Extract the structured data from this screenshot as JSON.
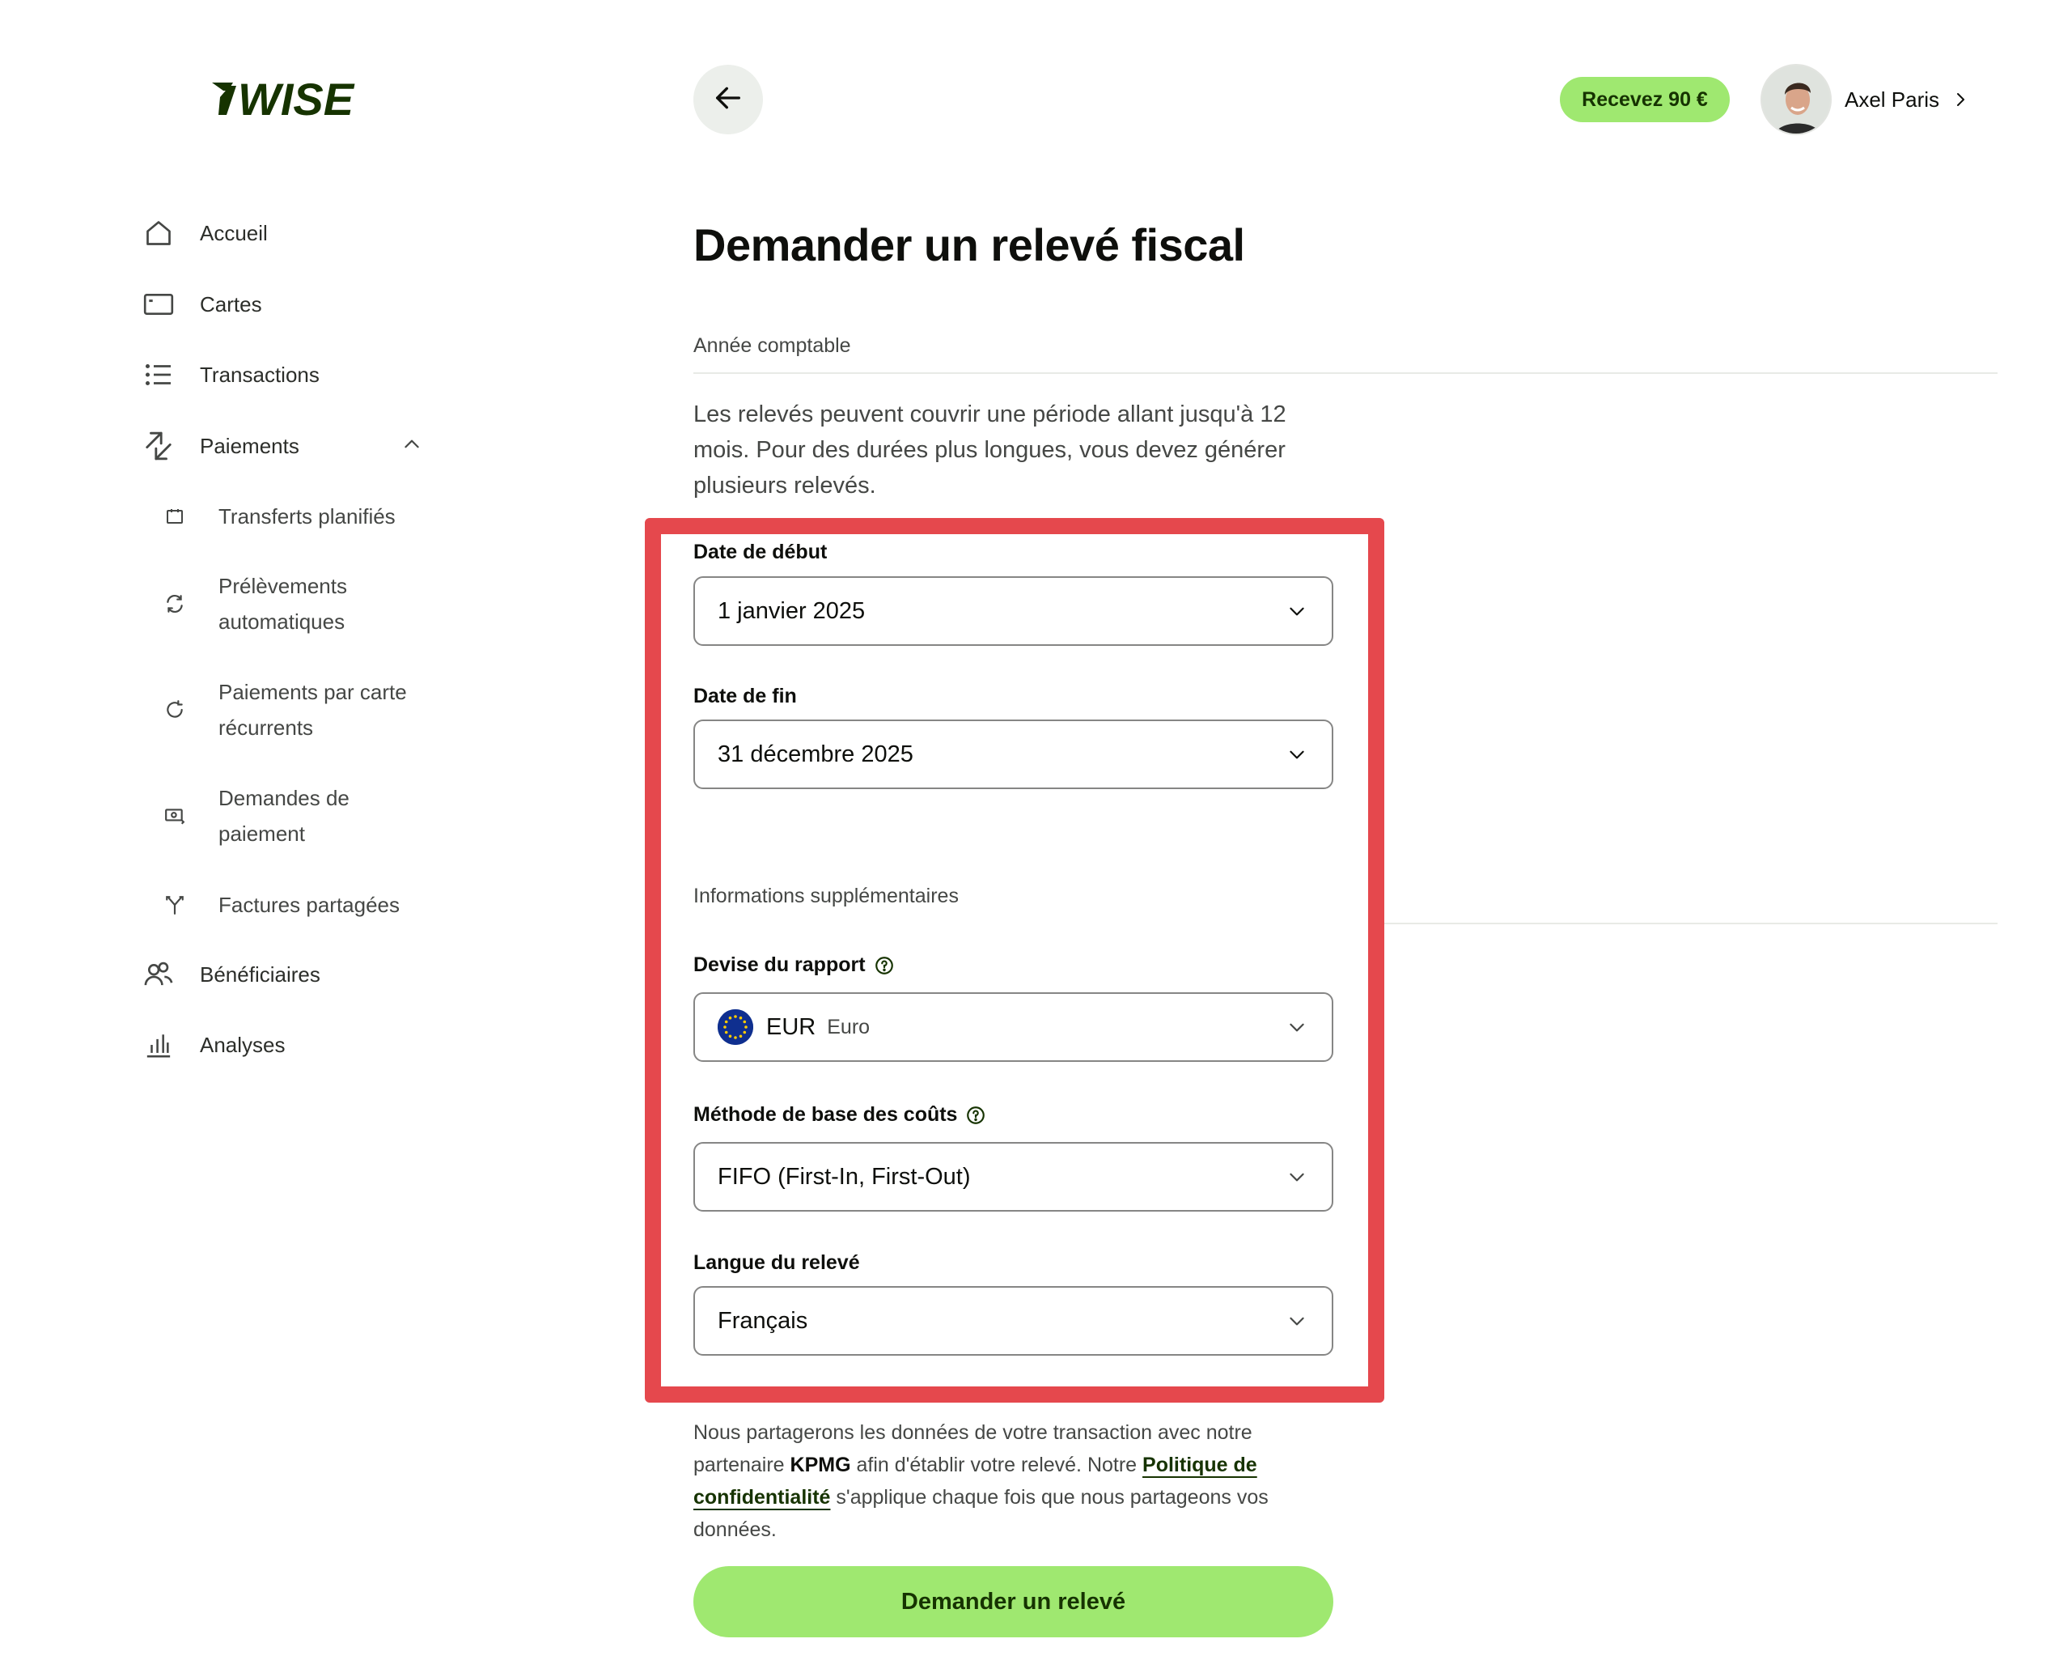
{
  "brand": {
    "logo_text": "WISE",
    "accent": "#9fe870",
    "dark_green": "#163300"
  },
  "sidebar": {
    "items": [
      {
        "label": "Accueil",
        "icon": "home-icon"
      },
      {
        "label": "Cartes",
        "icon": "card-icon"
      },
      {
        "label": "Transactions",
        "icon": "list-icon"
      },
      {
        "label": "Paiements",
        "icon": "payments-icon",
        "expanded": true
      },
      {
        "label": "Bénéficiaires",
        "icon": "recipients-icon"
      },
      {
        "label": "Analyses",
        "icon": "chart-icon"
      }
    ],
    "payments_sub": [
      {
        "label": "Transferts planifiés",
        "icon": "calendar-icon"
      },
      {
        "label": "Prélèvements automatiques",
        "icon": "refresh-icon"
      },
      {
        "label": "Paiements par carte récurrents",
        "icon": "recurring-icon"
      },
      {
        "label": "Demandes de paiement",
        "icon": "request-money-icon"
      },
      {
        "label": "Factures partagées",
        "icon": "split-icon"
      }
    ]
  },
  "header": {
    "reward_label": "Recevez 90 €",
    "user_name": "Axel Paris"
  },
  "main": {
    "title": "Demander un relevé fiscal",
    "section_accounting_year": "Année comptable",
    "intro": "Les relevés peuvent couvrir une période allant jusqu'à 12 mois. Pour des durées plus longues, vous devez générer plusieurs relevés.",
    "start_date": {
      "label": "Date de début",
      "value": "1 janvier 2025"
    },
    "end_date": {
      "label": "Date de fin",
      "value": "31 décembre 2025"
    },
    "section_additional": "Informations supplémentaires",
    "currency": {
      "label": "Devise du rapport",
      "code": "EUR",
      "name": "Euro"
    },
    "cost_method": {
      "label": "Méthode de base des coûts",
      "value": "FIFO (First-In, First-Out)"
    },
    "language": {
      "label": "Langue du relevé",
      "value": "Français"
    },
    "legal": {
      "part1": "Nous partagerons les données de votre transaction avec notre partenaire ",
      "partner": "KPMG",
      "part2": " afin d'établir votre relevé. Notre ",
      "link": "Politique de confidentialité",
      "part3": " s'applique chaque fois que nous partageons vos données."
    },
    "submit_label": "Demander un relevé"
  },
  "highlight_color": "#e5484d"
}
